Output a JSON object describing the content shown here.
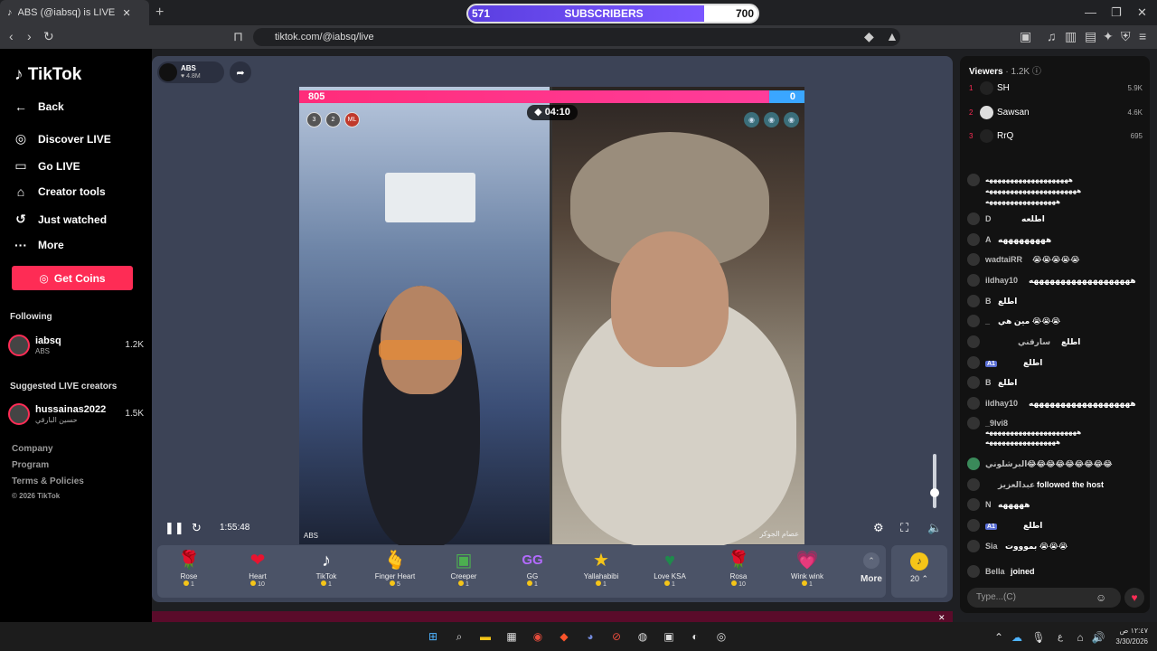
{
  "browser": {
    "tab_title": "ABS (@iabsq) is LIVE - TikTok",
    "new_tab": "+",
    "url": "tiktok.com/@iabsq/live",
    "subscriber_goal": {
      "current": "571",
      "label": "SUBSCRIBERS",
      "target": "700",
      "progress": 0.816
    }
  },
  "sidebar": {
    "logo": "TikTok",
    "nav": [
      {
        "icon": "back-arrow-icon",
        "label": "Back"
      },
      {
        "icon": "live-icon",
        "label": "Discover LIVE"
      },
      {
        "icon": "camera-icon",
        "label": "Go LIVE"
      },
      {
        "icon": "home-icon",
        "label": "Creator tools"
      },
      {
        "icon": "history-icon",
        "label": "Just watched"
      },
      {
        "icon": "ellipsis-icon",
        "label": "More"
      }
    ],
    "get_coins": "Get Coins",
    "following_title": "Following",
    "following": [
      {
        "name": "iabsq",
        "sub": "ABS",
        "viewers": "1.2K"
      }
    ],
    "suggested_title": "Suggested LIVE creators",
    "suggested": [
      {
        "name": "hussainas2022",
        "sub": "حسين البارقي",
        "viewers": "1.5K"
      }
    ],
    "footer": [
      "Company",
      "Program",
      "Terms & Policies",
      "© 2026 TikTok"
    ]
  },
  "stream": {
    "host_name": "ABS",
    "host_likes": "4.8M",
    "pk_left_score": "805",
    "pk_right_score": "0",
    "pk_left_share": 0.93,
    "timer": "04:10",
    "gifters": [
      "3",
      "2",
      "ML"
    ],
    "left_name": "ABS",
    "right_name": "عصام الجوكر",
    "elapsed": "1:55:48",
    "volume_level": 0.35
  },
  "gifts": [
    {
      "name": "Rose",
      "price": "1",
      "icon": "🌹"
    },
    {
      "name": "Heart",
      "price": "10",
      "icon": "❤"
    },
    {
      "name": "TikTok",
      "price": "1",
      "icon": "♪"
    },
    {
      "name": "Finger Heart",
      "price": "5",
      "icon": "🫰"
    },
    {
      "name": "Creeper",
      "price": "1",
      "icon": "▣"
    },
    {
      "name": "GG",
      "price": "1",
      "icon": "GG"
    },
    {
      "name": "Yallahabibi",
      "price": "1",
      "icon": "★"
    },
    {
      "name": "Love KSA",
      "price": "1",
      "icon": "♥"
    },
    {
      "name": "Rosa",
      "price": "10",
      "icon": "🌹"
    },
    {
      "name": "Wink wink",
      "price": "1",
      "icon": "💗"
    }
  ],
  "gifts_more": "More",
  "coin_balance": "20",
  "chat": {
    "viewers_label": "Viewers",
    "viewers_count": "· 1.2K",
    "top_viewers": [
      {
        "rank": "1",
        "name": "SH",
        "score": "5.9K"
      },
      {
        "rank": "2",
        "name": "Sawsan",
        "score": "4.6K"
      },
      {
        "rank": "3",
        "name": "RrQ",
        "score": "695"
      }
    ],
    "messages": [
      {
        "user": "",
        "text": "ههههههههههههههههههههه ههههههههههههههههههههههه هههههههههههههههههه"
      },
      {
        "user": "D",
        "text": "اطلعه"
      },
      {
        "user": "A",
        "text": "هههههههههه"
      },
      {
        "user": "wadtaiRR",
        "text": "😭😭😭😭😭"
      },
      {
        "user": "ildhay10",
        "text": "هههههههههههههههههههه"
      },
      {
        "user": "B",
        "text": "اطلع"
      },
      {
        "user": "_",
        "text": "مين هي 😭😭😭"
      },
      {
        "user": "سارقني",
        "text": "اطلع"
      },
      {
        "user": "A1",
        "text": "اطلع"
      },
      {
        "user": "B",
        "text": "اطلع"
      },
      {
        "user": "ildhay10",
        "text": "هههههههههههههههههههه"
      },
      {
        "user": "_9lvi8",
        "text": "ههههههههههههههههههههههه هههههههههههههههههه"
      },
      {
        "user": "البرشلوني",
        "text": "😂😂😂😂😂😂😂😂😂"
      },
      {
        "user": "عبدالعزيز",
        "text": "followed the host"
      },
      {
        "user": "N",
        "text": "هههههه"
      },
      {
        "user": "A1",
        "text": "اطلع"
      },
      {
        "user": "Sia",
        "text": "بموووت 😭😭😭"
      },
      {
        "user": "Bella",
        "text": "joined"
      }
    ],
    "input_placeholder": "Type...(C)"
  },
  "taskbar": {
    "time": "١٢:٤٧ ص",
    "date": "3/30/2026",
    "lang": "ع"
  }
}
